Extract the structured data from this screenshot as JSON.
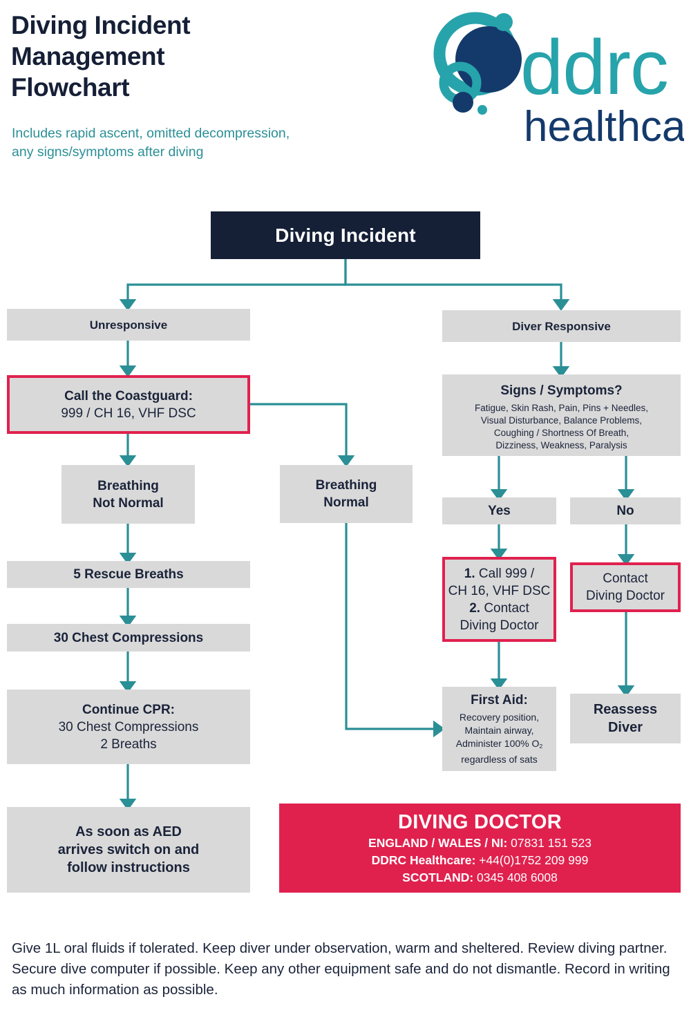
{
  "header": {
    "title": "Diving Incident\nManagement\nFlowchart",
    "subtitle": "Includes rapid ascent, omitted decompression,\nany signs/symptoms after diving",
    "logo_word_primary": "ddrc",
    "logo_word_secondary": "healthcare"
  },
  "colors": {
    "navy": "#151f36",
    "teal": "#2b8f96",
    "logo_teal": "#27a3ab",
    "logo_navy": "#143a6b",
    "red": "#e0214e",
    "box_grey": "#d9d9d9"
  },
  "flow": {
    "root": "Diving Incident",
    "unresponsive": "Unresponsive",
    "diver_responsive": "Diver Responsive",
    "coastguard_title": "Call the Coastguard:",
    "coastguard_detail": "999 / CH 16, VHF DSC",
    "breathing_not_normal": "Breathing\nNot Normal",
    "breathing_normal": "Breathing\nNormal",
    "rescue_breaths": "5 Rescue Breaths",
    "chest_compressions": "30 Chest Compressions",
    "continue_cpr_title": "Continue CPR:",
    "continue_cpr_detail": "30 Chest Compressions\n2 Breaths",
    "aed": "As soon as AED\narrives switch on and\nfollow instructions",
    "signs_title": "Signs / Symptoms?",
    "signs_detail": "Fatigue, Skin Rash, Pain, Pins + Needles,\nVisual Disturbance, Balance Problems,\nCoughing / Shortness Of Breath,\nDizziness, Weakness, Paralysis",
    "yes": "Yes",
    "no": "No",
    "yes_step1_num": "1.",
    "yes_step1_text": " Call 999 /",
    "yes_step1_line2": "CH 16, VHF DSC",
    "yes_step2_num": "2.",
    "yes_step2_text": " Contact",
    "yes_step2_line2": "Diving Doctor",
    "no_action": "Contact\nDiving Doctor",
    "first_aid_title": "First Aid:",
    "first_aid_l1": "Recovery position,",
    "first_aid_l2": "Maintain airway,",
    "first_aid_l3_a": "Administer 100% O",
    "first_aid_l3_sub": "2",
    "first_aid_l4": "regardless of sats",
    "reassess": "Reassess\nDiver"
  },
  "banner": {
    "title": "DIVING DOCTOR",
    "line1_label": "ENGLAND / WALES / NI:",
    "line1_value": " 07831 151 523",
    "line2_label": "DDRC Healthcare:",
    "line2_value": " +44(0)1752 209 999",
    "line3_label": "SCOTLAND:",
    "line3_value": " 0345 408 6008"
  },
  "footer": {
    "text": "Give 1L oral fluids if tolerated. Keep diver under observation, warm and sheltered. Review diving partner. Secure dive computer if possible. Keep any other equipment safe and do not dismantle. Record in writing as much information as possible."
  }
}
